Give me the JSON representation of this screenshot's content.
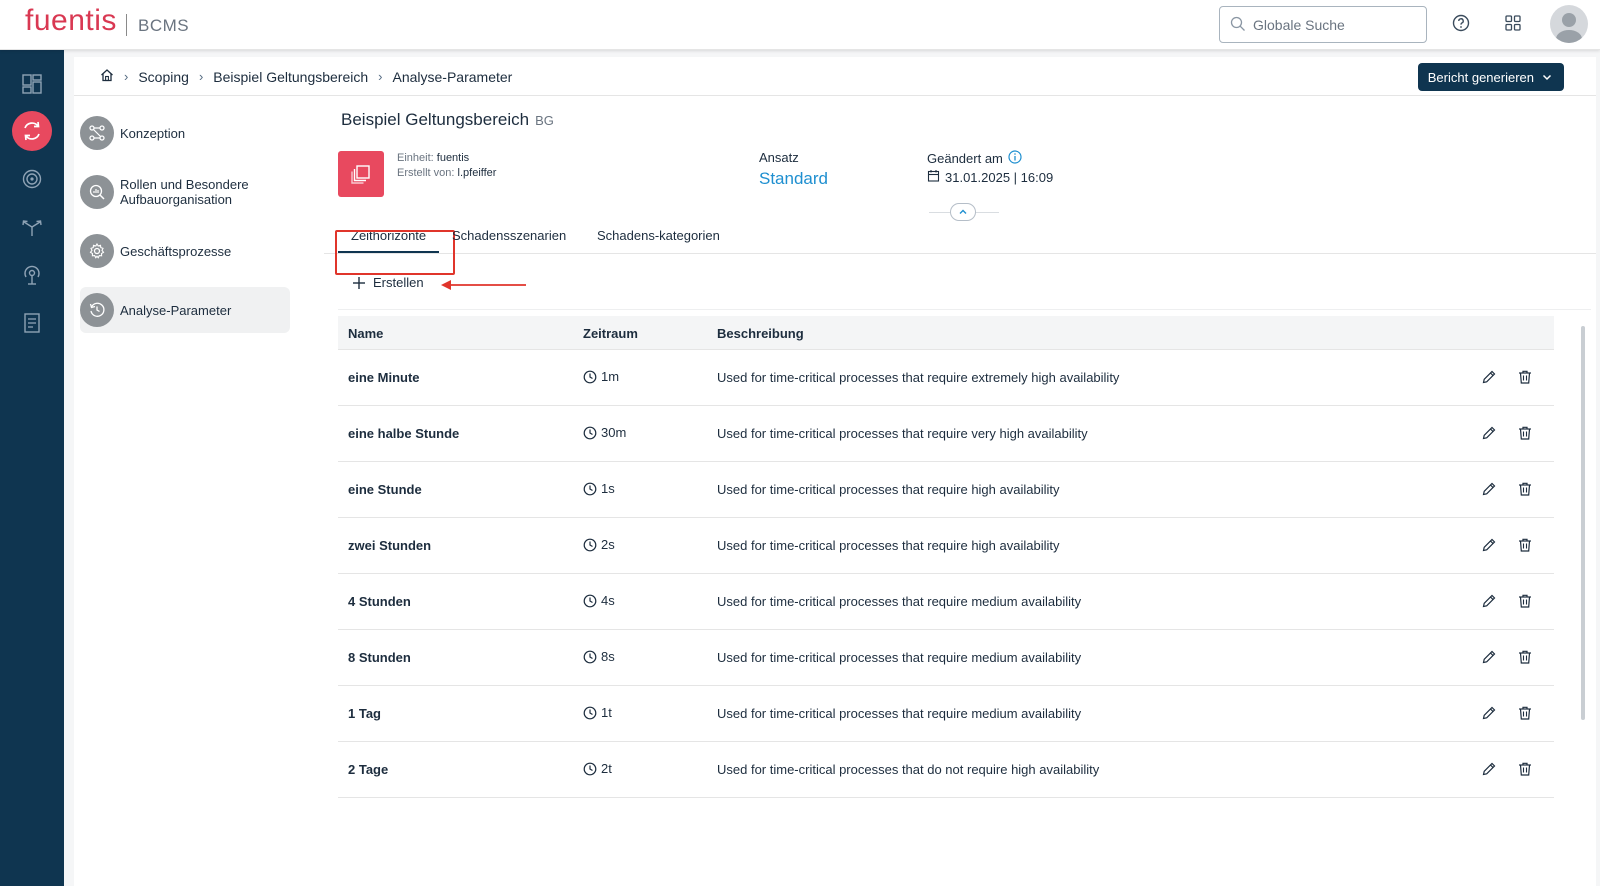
{
  "header": {
    "logo": "fuentis",
    "app_name": "BCMS",
    "search_placeholder": "Globale Suche",
    "help_icon": "help-icon",
    "apps_icon": "grid-icon",
    "avatar_icon": "user-avatar-icon"
  },
  "navbar": {
    "items": [
      {
        "name": "dashboard",
        "icon": "dashboard-icon",
        "active": false
      },
      {
        "name": "scoping",
        "icon": "cycle-icon",
        "active": true
      },
      {
        "name": "analysis",
        "icon": "target-icon",
        "active": false
      },
      {
        "name": "strategy",
        "icon": "split-arrows-icon",
        "active": false
      },
      {
        "name": "alerting",
        "icon": "broadcast-icon",
        "active": false
      },
      {
        "name": "reports",
        "icon": "report-icon",
        "active": false
      }
    ]
  },
  "breadcrumb": {
    "home_icon": "home-icon",
    "items": [
      "Scoping",
      "Beispiel Geltungsbereich",
      "Analyse-Parameter"
    ],
    "report_button": "Bericht generieren"
  },
  "subnav": {
    "items": [
      {
        "label": "Konzeption",
        "icon": "flow-icon",
        "active": false
      },
      {
        "label": "Rollen und Besondere Aufbauorganisation",
        "icon": "search-chart-icon",
        "active": false
      },
      {
        "label": "Geschäftsprozesse",
        "icon": "gear-icon",
        "active": false
      },
      {
        "label": "Analyse-Parameter",
        "icon": "history-icon",
        "active": true
      }
    ]
  },
  "object": {
    "title": "Beispiel Geltungsbereich",
    "abbr": "BG",
    "einheit_label": "Einheit:",
    "einheit_value": "fuentis",
    "erstellt_label": "Erstellt von:",
    "erstellt_value": "l.pfeiffer",
    "ansatz_label": "Ansatz",
    "ansatz_value": "Standard",
    "changed_label": "Geändert am",
    "changed_value": "31.01.2025 | 16:09",
    "accent": "#e8495f"
  },
  "tabs": [
    {
      "label": "Zeithorizonte",
      "active": true
    },
    {
      "label": "Schadensszenarien",
      "active": false
    },
    {
      "label": "Schadens-kategorien",
      "active": false
    }
  ],
  "toolbar": {
    "create_label": "Erstellen"
  },
  "table": {
    "columns": [
      "Name",
      "Zeitraum",
      "Beschreibung"
    ],
    "rows": [
      {
        "name": "eine Minute",
        "zeitraum": "1m",
        "beschreibung": "Used for time-critical processes that require extremely high availability"
      },
      {
        "name": "eine halbe Stunde",
        "zeitraum": "30m",
        "beschreibung": "Used for time-critical processes that require very high availability"
      },
      {
        "name": "eine Stunde",
        "zeitraum": "1s",
        "beschreibung": "Used for time-critical processes that require high availability"
      },
      {
        "name": "zwei Stunden",
        "zeitraum": "2s",
        "beschreibung": "Used for time-critical processes that require high availability"
      },
      {
        "name": "4 Stunden",
        "zeitraum": "4s",
        "beschreibung": "Used for time-critical processes that require medium availability"
      },
      {
        "name": "8 Stunden",
        "zeitraum": "8s",
        "beschreibung": "Used for time-critical processes that require medium availability"
      },
      {
        "name": "1 Tag",
        "zeitraum": "1t",
        "beschreibung": "Used for time-critical processes that require medium availability"
      },
      {
        "name": "2 Tage",
        "zeitraum": "2t",
        "beschreibung": "Used for time-critical processes that do not require high availability"
      }
    ]
  },
  "colors": {
    "navbar": "#0f3550",
    "active_nav": "#e8495f",
    "link": "#1e8fd0",
    "highlight": "#e0352b"
  }
}
